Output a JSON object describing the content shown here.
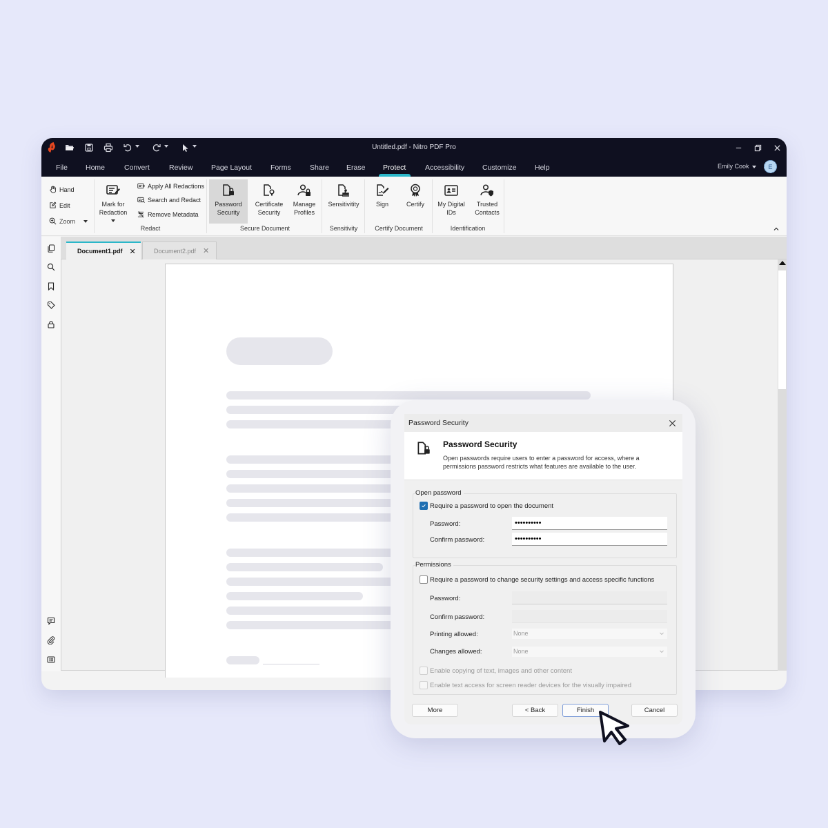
{
  "app": {
    "title": "Untitled.pdf - Nitro PDF Pro",
    "brand_color": "#e8471f",
    "accent_color": "#2bb7c9",
    "titlebar_color": "#0f1020"
  },
  "quick_access": {
    "icons": [
      "nitro-logo-icon",
      "open-folder-icon",
      "save-icon",
      "print-icon",
      "undo-icon",
      "redo-icon",
      "select-cursor-icon"
    ]
  },
  "window_controls": [
    "minimize",
    "restore",
    "close"
  ],
  "menu": {
    "items": [
      "File",
      "Home",
      "Convert",
      "Review",
      "Page Layout",
      "Forms",
      "Share",
      "Erase",
      "Protect",
      "Accessibility",
      "Customize",
      "Help"
    ],
    "active": "Protect"
  },
  "user": {
    "name": "Emily Cook",
    "initial": "E"
  },
  "ribbon": {
    "tools": {
      "hand": "Hand",
      "edit": "Edit",
      "zoom": "Zoom"
    },
    "redact": {
      "mark_line1": "Mark for",
      "mark_line2": "Redaction",
      "apply_all": "Apply All Redactions",
      "search_redact": "Search and Redact",
      "remove_metadata": "Remove Metadata",
      "group_label": "Redact"
    },
    "secure": {
      "password_line1": "Password",
      "password_line2": "Security",
      "certificate_line1": "Certificate",
      "certificate_line2": "Security",
      "manage_line1": "Manage",
      "manage_line2": "Profiles",
      "group_label": "Secure Document"
    },
    "sensitivity": {
      "button": "Sensitivitity",
      "group_label": "Sensitivity"
    },
    "certify": {
      "sign": "Sign",
      "certify": "Certify",
      "group_label": "Certify Document"
    },
    "identification": {
      "ids_line1": "My Digital",
      "ids_line2": "IDs",
      "contacts_line1": "Trusted",
      "contacts_line2": "Contacts",
      "group_label": "Identification"
    }
  },
  "left_rail": {
    "top_icons": [
      "pages-icon",
      "search-icon",
      "bookmark-icon",
      "tag-icon",
      "lock-icon"
    ],
    "bottom_icons": [
      "comment-icon",
      "attachment-icon",
      "fields-list-icon"
    ]
  },
  "doc_tabs": [
    {
      "label": "Document1.pdf",
      "active": true
    },
    {
      "label": "Document2.pdf",
      "active": false
    }
  ],
  "dialog": {
    "window_title": "Password Security",
    "heading": "Password Security",
    "description": "Open passwords require users to enter a password for access, where a permissions password restricts what features are available to the user.",
    "open_password": {
      "legend": "Open password",
      "require_label": "Require a password to open the document",
      "require_checked": true,
      "password_label": "Password:",
      "password_value": "••••••••••",
      "confirm_label": "Confirm password:",
      "confirm_value": "••••••••••"
    },
    "permissions": {
      "legend": "Permissions",
      "require_label": "Require a password to change security settings and access specific functions",
      "require_checked": false,
      "password_label": "Password:",
      "password_value": "",
      "confirm_label": "Confirm password:",
      "confirm_value": "",
      "printing_label": "Printing allowed:",
      "printing_value": "None",
      "changes_label": "Changes allowed:",
      "changes_value": "None",
      "copy_label": "Enable copying of text, images and other content",
      "copy_checked": false,
      "screen_reader_label": "Enable text access for screen reader devices for the visually impaired",
      "screen_reader_checked": false
    },
    "buttons": {
      "more": "More",
      "back": "< Back",
      "finish": "Finish",
      "cancel": "Cancel"
    }
  }
}
